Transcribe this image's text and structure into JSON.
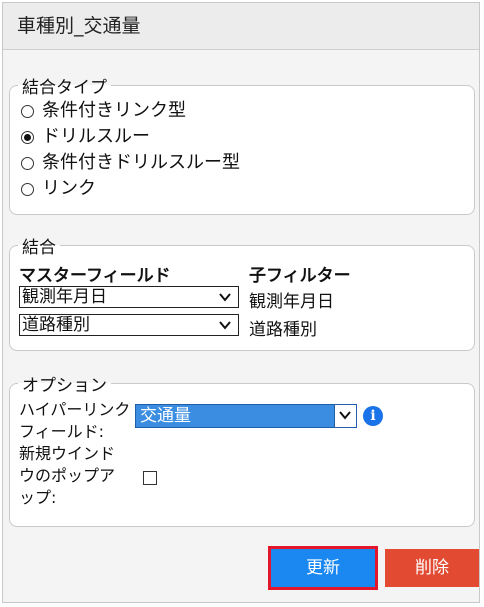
{
  "header": {
    "title": "車種別_交通量"
  },
  "join_type": {
    "legend": "結合タイプ",
    "options": [
      {
        "label": "条件付きリンク型",
        "selected": false
      },
      {
        "label": "ドリルスルー",
        "selected": true
      },
      {
        "label": "条件付きドリルスルー型",
        "selected": false
      },
      {
        "label": "リンク",
        "selected": false
      }
    ]
  },
  "join": {
    "legend": "結合",
    "master_field_header": "マスターフィールド",
    "child_filter_header": "子フィルター",
    "rows": [
      {
        "master_value": "観測年月日",
        "child_value": "観測年月日"
      },
      {
        "master_value": "道路種別",
        "child_value": "道路種別"
      }
    ]
  },
  "options": {
    "legend": "オプション",
    "hyperlink_label": "ハイパーリンクフィールド:",
    "hyperlink_value": "交通量",
    "new_window_label": "新規ウインドウのポップアップ:",
    "new_window_checked": false
  },
  "buttons": {
    "update": "更新",
    "delete": "削除"
  },
  "colors": {
    "update": "#1a88f0",
    "delete": "#e24b32",
    "highlight": "#e3162b",
    "info": "#1a73e8"
  }
}
